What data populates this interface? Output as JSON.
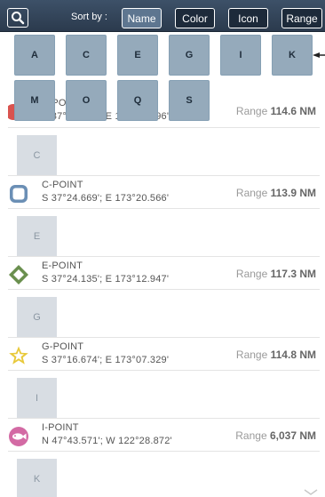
{
  "toolbar": {
    "search_icon": "magnifier-icon",
    "sort_label": "Sort by :",
    "sort_options": [
      "Name",
      "Color",
      "Icon",
      "Range"
    ],
    "active_sort": "Name"
  },
  "index_popup": {
    "row1": [
      "A",
      "C",
      "E",
      "G",
      "I",
      "K"
    ],
    "row2": [
      "M",
      "O",
      "Q",
      "S"
    ]
  },
  "list": {
    "partial_point": {
      "name": "A-POINT",
      "coords": "S 37°28.472'; E 173°23.396'",
      "range_label": "Range",
      "range_value": "114.6 NM",
      "icon": "red-circle-icon",
      "icon_color": "#d9534f"
    },
    "letters": [
      "C",
      "E",
      "G",
      "I",
      "K"
    ],
    "points": [
      {
        "name": "C-POINT",
        "coords": "S 37°24.669'; E 173°20.566'",
        "range_label": "Range",
        "range_value": "113.9 NM",
        "icon": "rounded-square-icon",
        "icon_color": "#6b8fb5"
      },
      {
        "name": "E-POINT",
        "coords": "S 37°24.135'; E 173°12.947'",
        "range_label": "Range",
        "range_value": "117.3 NM",
        "icon": "diamond-icon",
        "icon_color": "#6a8f4e"
      },
      {
        "name": "G-POINT",
        "coords": "S 37°16.674'; E 173°07.329'",
        "range_label": "Range",
        "range_value": "114.8 NM",
        "icon": "star-icon",
        "icon_color": "#e8c93a"
      },
      {
        "name": "I-POINT",
        "coords": "N 47°43.571'; W 122°28.872'",
        "range_label": "Range",
        "range_value": "6,037 NM",
        "icon": "fish-icon",
        "icon_color": "#d36aa4"
      }
    ]
  },
  "colors": {
    "toolbar_bg": "#2b3a4d",
    "key_bg": "#95aabb",
    "tile_bg": "#d8dde3"
  }
}
